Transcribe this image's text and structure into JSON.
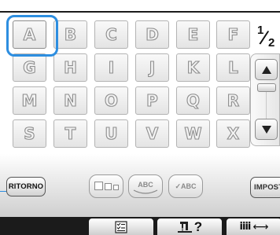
{
  "font_grid": {
    "rows": [
      [
        "A",
        "B",
        "C",
        "D",
        "E",
        "F"
      ],
      [
        "G",
        "H",
        "I",
        "J",
        "K",
        "L"
      ],
      [
        "M",
        "N",
        "O",
        "P",
        "Q",
        "R"
      ],
      [
        "S",
        "T",
        "U",
        "V",
        "W",
        "X"
      ]
    ],
    "selected": "A"
  },
  "pagination": {
    "current": "1",
    "total": "2"
  },
  "controls": {
    "ritorno_label": "RITORNO",
    "imposta_label": "IMPOSTA",
    "arc_label": "ABC",
    "check_label": "ABC"
  },
  "icons": {
    "scroll_up": "triangle-up-icon",
    "scroll_down": "triangle-down-icon",
    "list": "checklist-icon",
    "help": "sewing-machine-question-icon",
    "layout": "bars-arrow-icon"
  },
  "colors": {
    "selection": "#2d8ee0",
    "bottom_bar": "#1b1b1b"
  }
}
